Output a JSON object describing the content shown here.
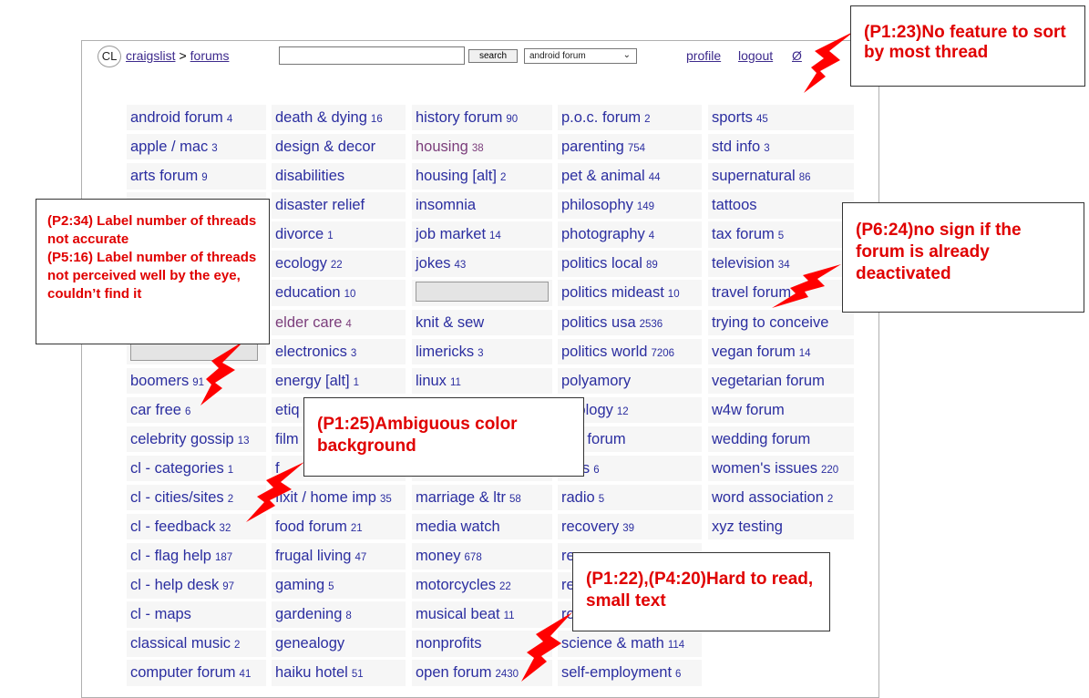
{
  "header": {
    "logo": "CL",
    "crumb_site": "craigslist",
    "crumb_sep": ">",
    "crumb_section": "forums",
    "search_value": "",
    "search_button": "search",
    "forum_select": "android forum",
    "profile": "profile",
    "logout": "logout",
    "null_link": "Ø"
  },
  "columns": [
    [
      {
        "label": "android forum",
        "count": "4"
      },
      {
        "label": "apple / mac",
        "count": "3"
      },
      {
        "label": "arts forum",
        "count": "9"
      },
      {
        "label": "",
        "count": ""
      },
      {
        "label": "",
        "count": ""
      },
      {
        "label": "",
        "count": ""
      },
      {
        "label": "",
        "count": ""
      },
      {
        "label": "",
        "count": ""
      },
      {
        "label": "",
        "count": ""
      },
      {
        "label": "boomers",
        "count": "91"
      },
      {
        "label": "car free",
        "count": "6"
      },
      {
        "label": "celebrity gossip",
        "count": "13"
      },
      {
        "label": "cl - categories",
        "count": "1"
      },
      {
        "label": "cl - cities/sites",
        "count": "2"
      },
      {
        "label": "cl - feedback",
        "count": "32"
      },
      {
        "label": "cl - flag help",
        "count": "187"
      },
      {
        "label": "cl - help desk",
        "count": "97"
      },
      {
        "label": "cl - maps",
        "count": ""
      },
      {
        "label": "classical music",
        "count": "2"
      },
      {
        "label": "computer forum",
        "count": "41"
      }
    ],
    [
      {
        "label": "death & dying",
        "count": "16"
      },
      {
        "label": "design & decor",
        "count": ""
      },
      {
        "label": "disabilities",
        "count": ""
      },
      {
        "label": "disaster relief",
        "count": ""
      },
      {
        "label": "divorce",
        "count": "1"
      },
      {
        "label": "ecology",
        "count": "22"
      },
      {
        "label": "education",
        "count": "10"
      },
      {
        "label": "elder care",
        "count": "4"
      },
      {
        "label": "electronics",
        "count": "3"
      },
      {
        "label": "energy [alt]",
        "count": "1"
      },
      {
        "label": "etiq",
        "count": ""
      },
      {
        "label": "film",
        "count": ""
      },
      {
        "label": "f",
        "count": ""
      },
      {
        "label": "fixit / home imp",
        "count": "35"
      },
      {
        "label": "food forum",
        "count": "21"
      },
      {
        "label": "frugal living",
        "count": "47"
      },
      {
        "label": "gaming",
        "count": "5"
      },
      {
        "label": "gardening",
        "count": "8"
      },
      {
        "label": "genealogy",
        "count": ""
      },
      {
        "label": "haiku hotel",
        "count": "51"
      }
    ],
    [
      {
        "label": "history forum",
        "count": "90"
      },
      {
        "label": "housing",
        "count": "38"
      },
      {
        "label": "housing [alt]",
        "count": "2"
      },
      {
        "label": "insomnia",
        "count": ""
      },
      {
        "label": "job market",
        "count": "14"
      },
      {
        "label": "jokes",
        "count": "43"
      },
      {
        "label": "",
        "count": ""
      },
      {
        "label": "knit & sew",
        "count": ""
      },
      {
        "label": "limericks",
        "count": "3"
      },
      {
        "label": "linux",
        "count": "11"
      },
      {
        "label": "",
        "count": ""
      },
      {
        "label": "",
        "count": ""
      },
      {
        "label": "",
        "count": ""
      },
      {
        "label": "marriage & ltr",
        "count": "58"
      },
      {
        "label": "media watch",
        "count": ""
      },
      {
        "label": "money",
        "count": "678"
      },
      {
        "label": "motorcycles",
        "count": "22"
      },
      {
        "label": "musical beat",
        "count": "11"
      },
      {
        "label": "nonprofits",
        "count": ""
      },
      {
        "label": "open forum",
        "count": "2430"
      }
    ],
    [
      {
        "label": "p.o.c. forum",
        "count": "2"
      },
      {
        "label": "parenting",
        "count": "754"
      },
      {
        "label": "pet & animal",
        "count": "44"
      },
      {
        "label": "philosophy",
        "count": "149"
      },
      {
        "label": "photography",
        "count": "4"
      },
      {
        "label": "politics local",
        "count": "89"
      },
      {
        "label": "politics mideast",
        "count": "10"
      },
      {
        "label": "politics usa",
        "count": "2536"
      },
      {
        "label": "politics world",
        "count": "7206"
      },
      {
        "label": "polyamory",
        "count": ""
      },
      {
        "label": "chology",
        "count": "12"
      },
      {
        "label": "eer forum",
        "count": ""
      },
      {
        "label": "otes",
        "count": "6"
      },
      {
        "label": "radio",
        "count": "5"
      },
      {
        "label": "recovery",
        "count": "39"
      },
      {
        "label": "re",
        "count": ""
      },
      {
        "label": "re",
        "count": ""
      },
      {
        "label": "ro",
        "count": ""
      },
      {
        "label": "science & math",
        "count": "114"
      },
      {
        "label": "self-employment",
        "count": "6"
      }
    ],
    [
      {
        "label": "sports",
        "count": "45"
      },
      {
        "label": "std info",
        "count": "3"
      },
      {
        "label": "supernatural",
        "count": "86"
      },
      {
        "label": "tattoos",
        "count": ""
      },
      {
        "label": "tax forum",
        "count": "5"
      },
      {
        "label": "television",
        "count": "34"
      },
      {
        "label": "travel forum",
        "count": ""
      },
      {
        "label": "trying to conceive",
        "count": ""
      },
      {
        "label": "vegan forum",
        "count": "14"
      },
      {
        "label": "vegetarian forum",
        "count": ""
      },
      {
        "label": "w4w forum",
        "count": ""
      },
      {
        "label": "wedding forum",
        "count": ""
      },
      {
        "label": "women's issues",
        "count": "220"
      },
      {
        "label": "word association",
        "count": "2"
      },
      {
        "label": "xyz testing",
        "count": ""
      },
      {
        "label": "",
        "count": ""
      },
      {
        "label": "",
        "count": ""
      },
      {
        "label": "",
        "count": ""
      },
      {
        "label": "",
        "count": ""
      },
      {
        "label": "",
        "count": ""
      }
    ]
  ],
  "annotations": {
    "sort": "(P1:23)No feature to sort by most thread",
    "label_accuracy": "(P2:34) Label number of threads not accurate",
    "label_perceived": "(P5:16) Label number of threads not perceived well by the eye, couldn’t find it",
    "deactivated": "(P6:24)no sign if the forum is already deactivated",
    "color": "(P1:25)Ambiguous color background",
    "small_text": "(P1:22),(P4:20)Hard to read, small text"
  },
  "colors": {
    "link": "#2b2ea0",
    "visited": "#7b3d7b",
    "note": "#e00000",
    "cell_bg": "#f6f6f6"
  }
}
